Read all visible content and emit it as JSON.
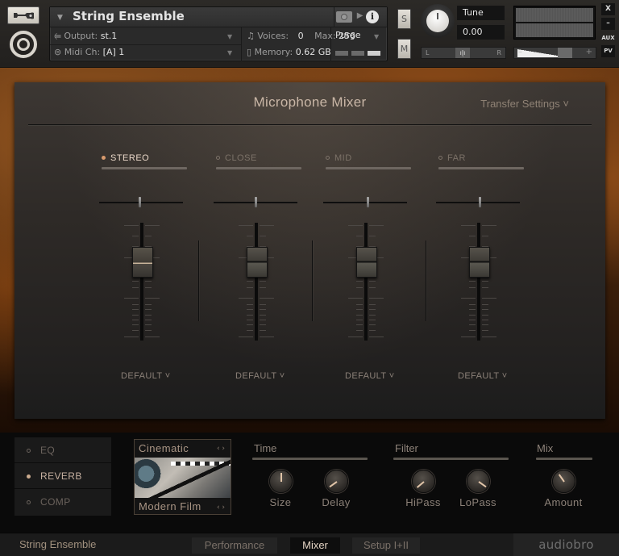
{
  "header": {
    "instrument_name": "String Ensemble",
    "output_label": "Output:",
    "output_value": "st.1",
    "midi_label": "Midi Ch:",
    "midi_value": "[A] 1",
    "voices_label": "Voices:",
    "voices_value": "0",
    "max_label": "Max:",
    "max_value": "256",
    "memory_label": "Memory:",
    "memory_value": "0.62 GB",
    "purge_label": "Purge",
    "solo_label": "S",
    "mute_label": "M",
    "tune_label": "Tune",
    "tune_value": "0.00",
    "pan_left": "L",
    "pan_right": "R",
    "aux_label": "AUX",
    "pv_label": "PV",
    "close_label": "X",
    "minimize_label": "–",
    "vol_minus": "–",
    "vol_plus": "+"
  },
  "mixer": {
    "title": "Microphone Mixer",
    "transfer_settings": "Transfer Settings ˅",
    "channels": [
      {
        "name": "STEREO",
        "active": true,
        "preset": "DEFAULT ˅",
        "pan": 0.48,
        "level": 0.78
      },
      {
        "name": "CLOSE",
        "active": false,
        "preset": "DEFAULT ˅",
        "pan": 0.5,
        "level": 0.78
      },
      {
        "name": "MID",
        "active": false,
        "preset": "DEFAULT ˅",
        "pan": 0.53,
        "level": 0.78
      },
      {
        "name": "FAR",
        "active": false,
        "preset": "DEFAULT ˅",
        "pan": 0.52,
        "level": 0.78
      }
    ]
  },
  "effects": {
    "items": [
      {
        "label": "EQ",
        "active": false
      },
      {
        "label": "REVERB",
        "active": true
      },
      {
        "label": "COMP",
        "active": false
      }
    ],
    "preset_category": "Cinematic",
    "preset_name": "Modern Film",
    "preset_arrows": "‹ ›",
    "groups": [
      {
        "label": "Time"
      },
      {
        "label": "Filter"
      },
      {
        "label": "Mix"
      }
    ],
    "knobs": [
      {
        "label": "Size",
        "angle_deg": 0
      },
      {
        "label": "Delay",
        "angle_deg": -125
      },
      {
        "label": "HiPass",
        "angle_deg": -130
      },
      {
        "label": "LoPass",
        "angle_deg": 125
      },
      {
        "label": "Amount",
        "angle_deg": -35
      }
    ]
  },
  "footer": {
    "instrument_name": "String Ensemble",
    "tabs": [
      {
        "label": "Performance",
        "active": false
      },
      {
        "label": "Mixer",
        "active": true
      },
      {
        "label": "Setup I+II",
        "active": false
      }
    ],
    "brand": "audiobro"
  }
}
